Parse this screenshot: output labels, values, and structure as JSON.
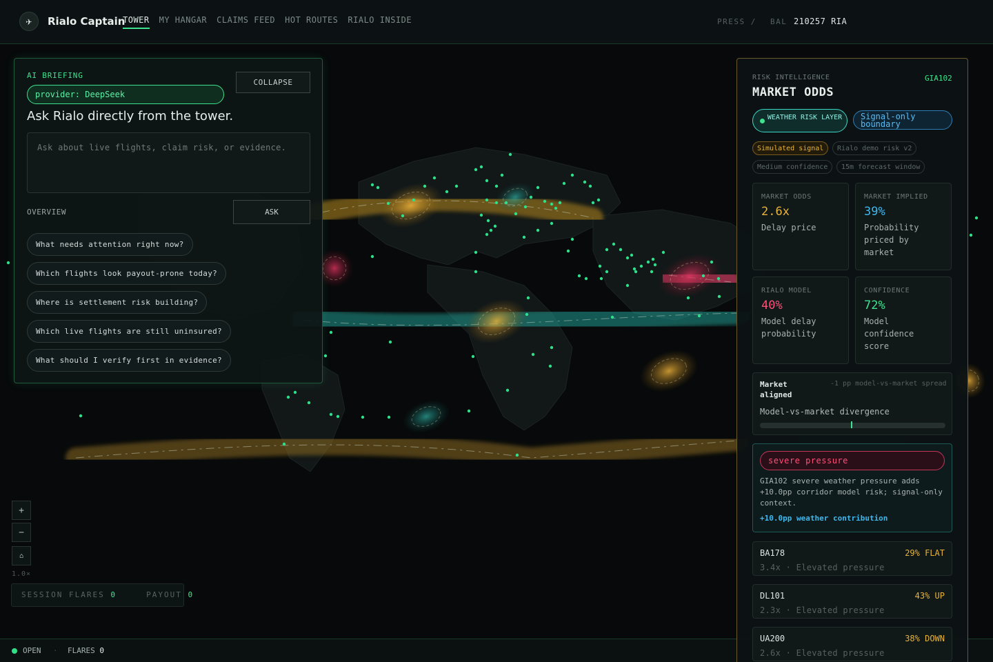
{
  "app": {
    "brand": "Rialo Captain",
    "nav": [
      "TOWER",
      "MY HANGAR",
      "CLAIMS FEED",
      "HOT ROUTES",
      "RIALO INSIDE"
    ],
    "active_nav": "TOWER",
    "press_label": "PRESS /",
    "balance_label": "BAL",
    "balance_value": "210257 RIA"
  },
  "briefing": {
    "kicker": "AI BRIEFING",
    "collapse_label": "COLLAPSE",
    "provider": "provider: DeepSeek",
    "title": "Ask Rialo directly from the tower.",
    "input_placeholder": "Ask about live flights, claim risk, or evidence.",
    "overview_label": "OVERVIEW",
    "ask_label": "ASK",
    "questions": [
      "What needs attention right now?",
      "Which flights look payout-prone today?",
      "Where is settlement risk building?",
      "Which live flights are still uninsured?",
      "What should I verify first in evidence?"
    ]
  },
  "map_controls": {
    "zoom_in": "+",
    "zoom_out": "−",
    "home": "⌂",
    "zoom_level": "1.0×",
    "session_label": "SESSION FLARES",
    "session_value": "0",
    "payout_label": "PAYOUT",
    "payout_value": "0"
  },
  "status": {
    "state": "OPEN",
    "separator": "·",
    "flares_label": "FLARES",
    "flares_value": "0"
  },
  "risk": {
    "kicker": "RISK INTELLIGENCE",
    "flight_id": "GIA102",
    "title": "MARKET ODDS",
    "weather_layer": "WEATHER RISK LAYER",
    "signal_boundary": "Signal-only boundary",
    "tags": [
      "Simulated signal",
      "Rialo demo risk v2",
      "Medium confidence",
      "15m forecast window"
    ],
    "metrics": [
      {
        "label": "MARKET ODDS",
        "value": "2.6x",
        "desc": "Delay price",
        "color": "#e9b43a"
      },
      {
        "label": "MARKET IMPLIED",
        "value": "39%",
        "desc": "Probability priced by market",
        "color": "#3fb8ee"
      },
      {
        "label": "RIALO MODEL",
        "value": "40%",
        "desc": "Model delay probability",
        "color": "#ff4f78"
      },
      {
        "label": "CONFIDENCE",
        "value": "72%",
        "desc": "Model confidence score",
        "color": "#3ee38f"
      }
    ],
    "spread_status": "Market aligned",
    "spread_note": "-1 pp model-vs-market spread",
    "divergence_label": "Model-vs-market divergence",
    "divergence_fraction": 0.49,
    "pressure_label": "severe pressure",
    "pressure_text": "GIA102 severe weather pressure adds +10.0pp corridor model risk; signal-only context.",
    "weather_contribution": "+10.0pp weather contribution",
    "flights": [
      {
        "id": "BA178",
        "trend": "29% FLAT",
        "meta": "3.4x · Elevated pressure"
      },
      {
        "id": "DL101",
        "trend": "43% UP",
        "meta": "2.3x · Elevated pressure"
      },
      {
        "id": "UA200",
        "trend": "38% DOWN",
        "meta": "2.6x · Elevated pressure"
      }
    ]
  },
  "colors": {
    "accent_green": "#3ee38f",
    "amber": "#e9b43a",
    "cyan": "#3fb8ee",
    "danger": "#ff4f78",
    "teal_corridor": "#1f8f86",
    "amber_corridor": "#8a6a1c"
  }
}
